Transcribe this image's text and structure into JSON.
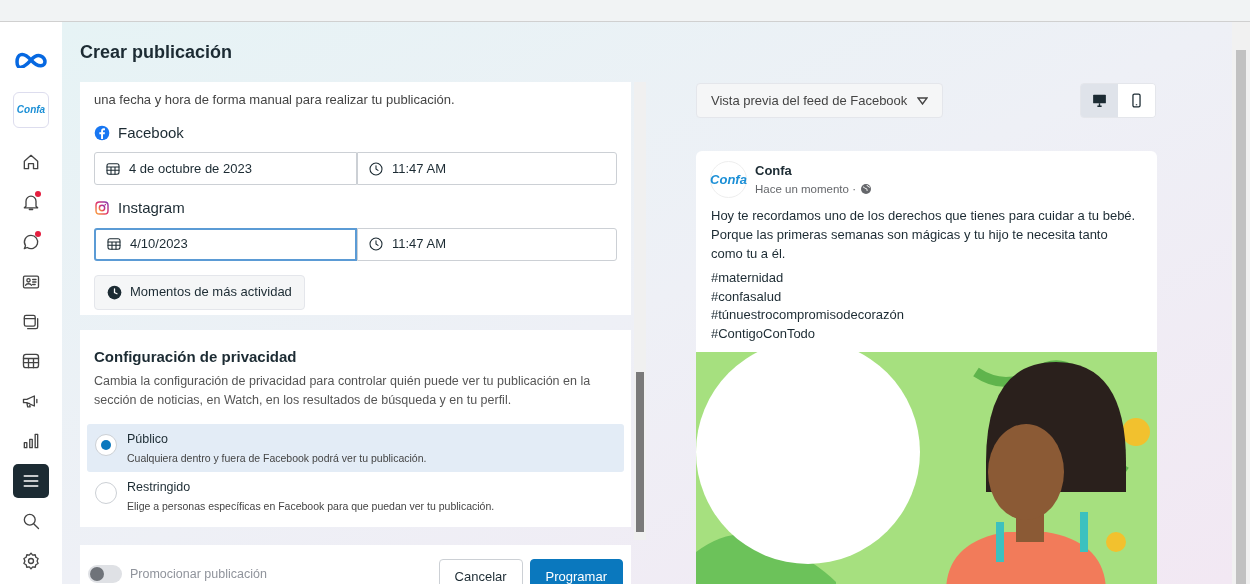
{
  "sidebar": {
    "page_logo": "Confa",
    "items": [
      {
        "kind": "home",
        "selected": false,
        "badge": false
      },
      {
        "kind": "bell",
        "selected": false,
        "badge": true
      },
      {
        "kind": "chat",
        "selected": false,
        "badge": true
      },
      {
        "kind": "idcard",
        "selected": false,
        "badge": false
      },
      {
        "kind": "layers",
        "selected": false,
        "badge": false
      },
      {
        "kind": "table",
        "selected": false,
        "badge": false
      },
      {
        "kind": "megaphone",
        "selected": false,
        "badge": false
      },
      {
        "kind": "chart",
        "selected": false,
        "badge": false
      },
      {
        "kind": "menu",
        "selected": true,
        "badge": false
      },
      {
        "kind": "search",
        "selected": false,
        "badge": false
      },
      {
        "kind": "settings",
        "selected": false,
        "badge": false
      }
    ]
  },
  "header": {
    "title": "Crear publicación"
  },
  "schedule": {
    "intro": "una fecha y hora de forma manual para realizar tu publicación.",
    "platforms": [
      {
        "kind": "facebook",
        "label": "Facebook",
        "date": "4 de octubre de 2023",
        "time": "11:47 AM",
        "focused": false
      },
      {
        "kind": "instagram",
        "label": "Instagram",
        "date": "4/10/2023",
        "time": "11:47 AM",
        "focused": true
      }
    ],
    "activity_button": "Momentos de más actividad"
  },
  "privacy": {
    "title": "Configuración de privacidad",
    "description": "Cambia la configuración de privacidad para controlar quién puede ver tu publicación en la sección de noticias, en Watch, en los resultados de búsqueda y en tu perfil.",
    "options": [
      {
        "label": "Público",
        "description": "Cualquiera dentro y fuera de Facebook podrá ver tu publicación.",
        "selected": true
      },
      {
        "label": "Restringido",
        "description": "Elige a personas específicas en Facebook para que puedan ver tu publicación.",
        "selected": false
      }
    ]
  },
  "footer": {
    "promote": {
      "label": "Promocionar publicación",
      "on": false
    },
    "buttons": [
      {
        "label": "Cancelar",
        "kind": "secondary"
      },
      {
        "label": "Programar",
        "kind": "primary"
      }
    ]
  },
  "preview": {
    "placement": "Vista previa del feed de Facebook",
    "devices": [
      {
        "kind": "desktop",
        "selected": true
      },
      {
        "kind": "mobile",
        "selected": false
      }
    ],
    "post": {
      "avatar_logo": "Confa",
      "author": "Confa",
      "time": "Hace un momento ·",
      "text": "Hoy te recordamos uno de los derechos que tienes para cuidar a tu bebé. Porque las primeras semanas son mágicas y tu hijo te necesita tanto como tu a él.",
      "hashtags": [
        "#maternidad",
        "#confasalud",
        "#túnuestrocompromisodecorazón",
        "#ContigoConTodo"
      ]
    }
  }
}
